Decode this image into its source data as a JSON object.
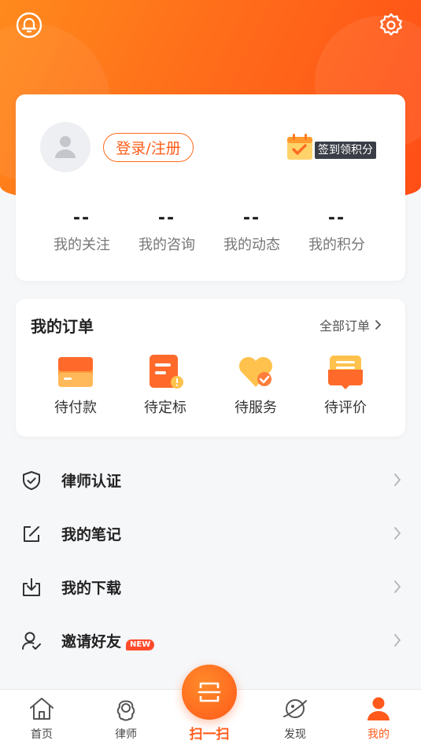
{
  "header": {
    "bell_icon": "bell-icon",
    "settings_icon": "gear-icon",
    "accent_color": "#ff6a1f"
  },
  "profile": {
    "login_label": "登录/注册",
    "signin_label": "签到领积分",
    "stats": [
      {
        "value": "--",
        "label": "我的关注"
      },
      {
        "value": "--",
        "label": "我的咨询"
      },
      {
        "value": "--",
        "label": "我的动态"
      },
      {
        "value": "--",
        "label": "我的积分"
      }
    ]
  },
  "orders": {
    "title": "我的订单",
    "all_label": "全部订单",
    "items": [
      {
        "label": "待付款",
        "icon": "wallet-icon"
      },
      {
        "label": "待定标",
        "icon": "document-icon"
      },
      {
        "label": "待服务",
        "icon": "heart-check-icon"
      },
      {
        "label": "待评价",
        "icon": "comment-icon"
      }
    ]
  },
  "menu": [
    {
      "label": "律师认证",
      "icon": "shield-check-icon"
    },
    {
      "label": "我的笔记",
      "icon": "edit-icon"
    },
    {
      "label": "我的下载",
      "icon": "download-icon"
    },
    {
      "label": "邀请好友",
      "icon": "invite-user-icon",
      "badge": "NEW"
    }
  ],
  "tabbar": {
    "tabs": [
      {
        "label": "首页",
        "icon": "home-icon"
      },
      {
        "label": "律师",
        "icon": "lawyer-icon"
      },
      {
        "label": "发现",
        "icon": "planet-icon"
      },
      {
        "label": "我的",
        "icon": "person-icon",
        "active": true
      }
    ],
    "scan_label": "扫一扫"
  }
}
